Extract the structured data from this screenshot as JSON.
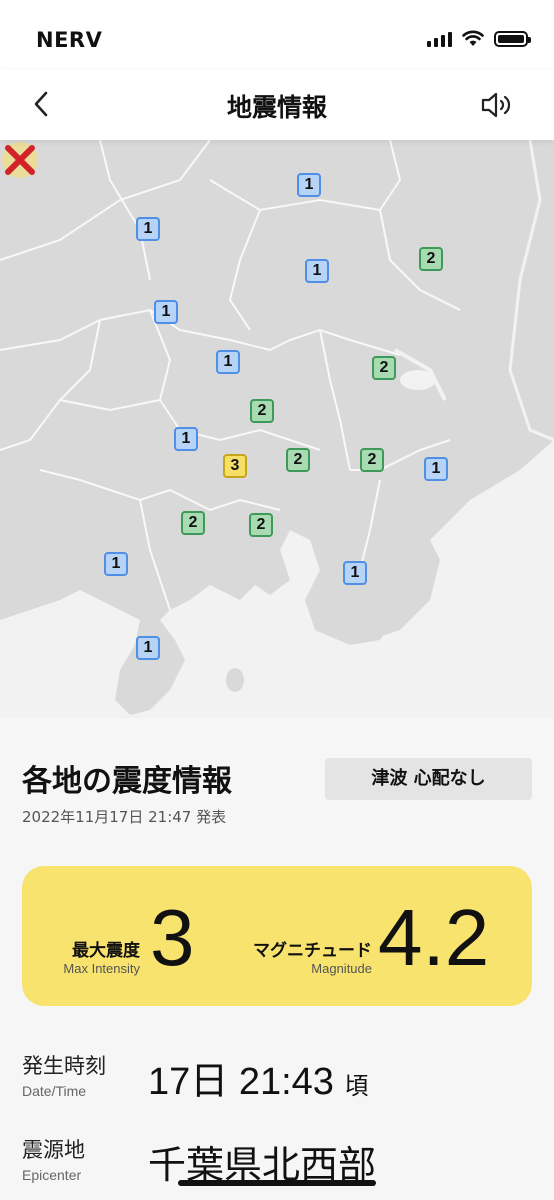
{
  "status_bar": {
    "carrier": "NERV"
  },
  "nav": {
    "title": "地震情報"
  },
  "map": {
    "stations": [
      {
        "intensity": "1",
        "level": 1
      },
      {
        "intensity": "1",
        "level": 1
      },
      {
        "intensity": "1",
        "level": 1
      },
      {
        "intensity": "2",
        "level": 2
      },
      {
        "intensity": "1",
        "level": 1
      },
      {
        "intensity": "1",
        "level": 1
      },
      {
        "intensity": "2",
        "level": 2
      },
      {
        "intensity": "2",
        "level": 2
      },
      {
        "intensity": "1",
        "level": 1
      },
      {
        "intensity": "3",
        "level": 3
      },
      {
        "intensity": "2",
        "level": 2
      },
      {
        "intensity": "2",
        "level": 2
      },
      {
        "intensity": "1",
        "level": 1
      },
      {
        "intensity": "2",
        "level": 2
      },
      {
        "intensity": "2",
        "level": 2
      },
      {
        "intensity": "1",
        "level": 1
      },
      {
        "intensity": "1",
        "level": 1
      },
      {
        "intensity": "1",
        "level": 1
      }
    ],
    "colors": {
      "level1": "#b7d3f6",
      "level2": "#a8dbb1",
      "level3": "#f5e065",
      "epicenter": "#d2232a"
    }
  },
  "info": {
    "section_title": "各地の震度情報",
    "tsunami": "津波 心配なし",
    "announced": "2022年11月17日 21:47 発表",
    "max_intensity_label_jp": "最大震度",
    "max_intensity_label_en": "Max Intensity",
    "max_intensity": "3",
    "magnitude_label_jp": "マグニチュード",
    "magnitude_label_en": "Magnitude",
    "magnitude": "4.2",
    "datetime_label_jp": "発生時刻",
    "datetime_label_en": "Date/Time",
    "datetime_value": "17日 21:43",
    "datetime_suffix": "頃",
    "epicenter_label_jp": "震源地",
    "epicenter_label_en": "Epicenter",
    "epicenter_value": "千葉県北西部"
  }
}
